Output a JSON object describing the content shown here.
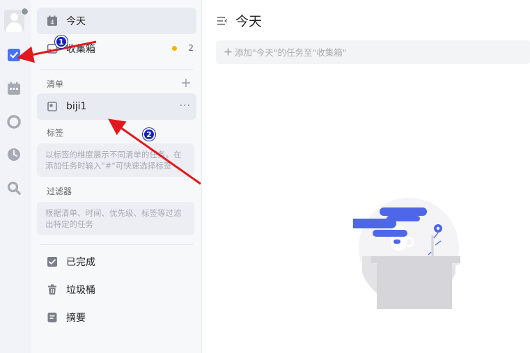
{
  "rail": {
    "icons": [
      "avatar",
      "checkbox-icon",
      "calendar-icon",
      "pomodoro-icon",
      "clock-icon",
      "search-icon"
    ]
  },
  "sidebar": {
    "today": {
      "label": "今天",
      "day": "4"
    },
    "inbox": {
      "label": "收集箱",
      "count": "2"
    },
    "lists_title": "清单",
    "lists": [
      {
        "label": "biji1",
        "more": "···"
      }
    ],
    "tags_title": "标签",
    "tags_hint": "以标签的维度展示不同清单的任务。在添加任务时输入\"#\"可快速选择标签",
    "filters_title": "过滤器",
    "filters_hint": "根据清单、时间、优先级、标签等过滤出特定的任务",
    "completed": "已完成",
    "trash": "垃圾桶",
    "summary": "摘要"
  },
  "main": {
    "title": "今天",
    "add_placeholder": "添加\"今天\"的任务至\"收集箱\""
  },
  "annotations": {
    "badge1": "1",
    "badge2": "2",
    "arrow_color": "#e0191e",
    "badge_color": "#1624b6"
  },
  "colors": {
    "accent": "#4772fa",
    "rail_bg": "#f1f3f8",
    "panel_bg": "#f7f8fa",
    "inbox_dot": "#f5b400"
  }
}
